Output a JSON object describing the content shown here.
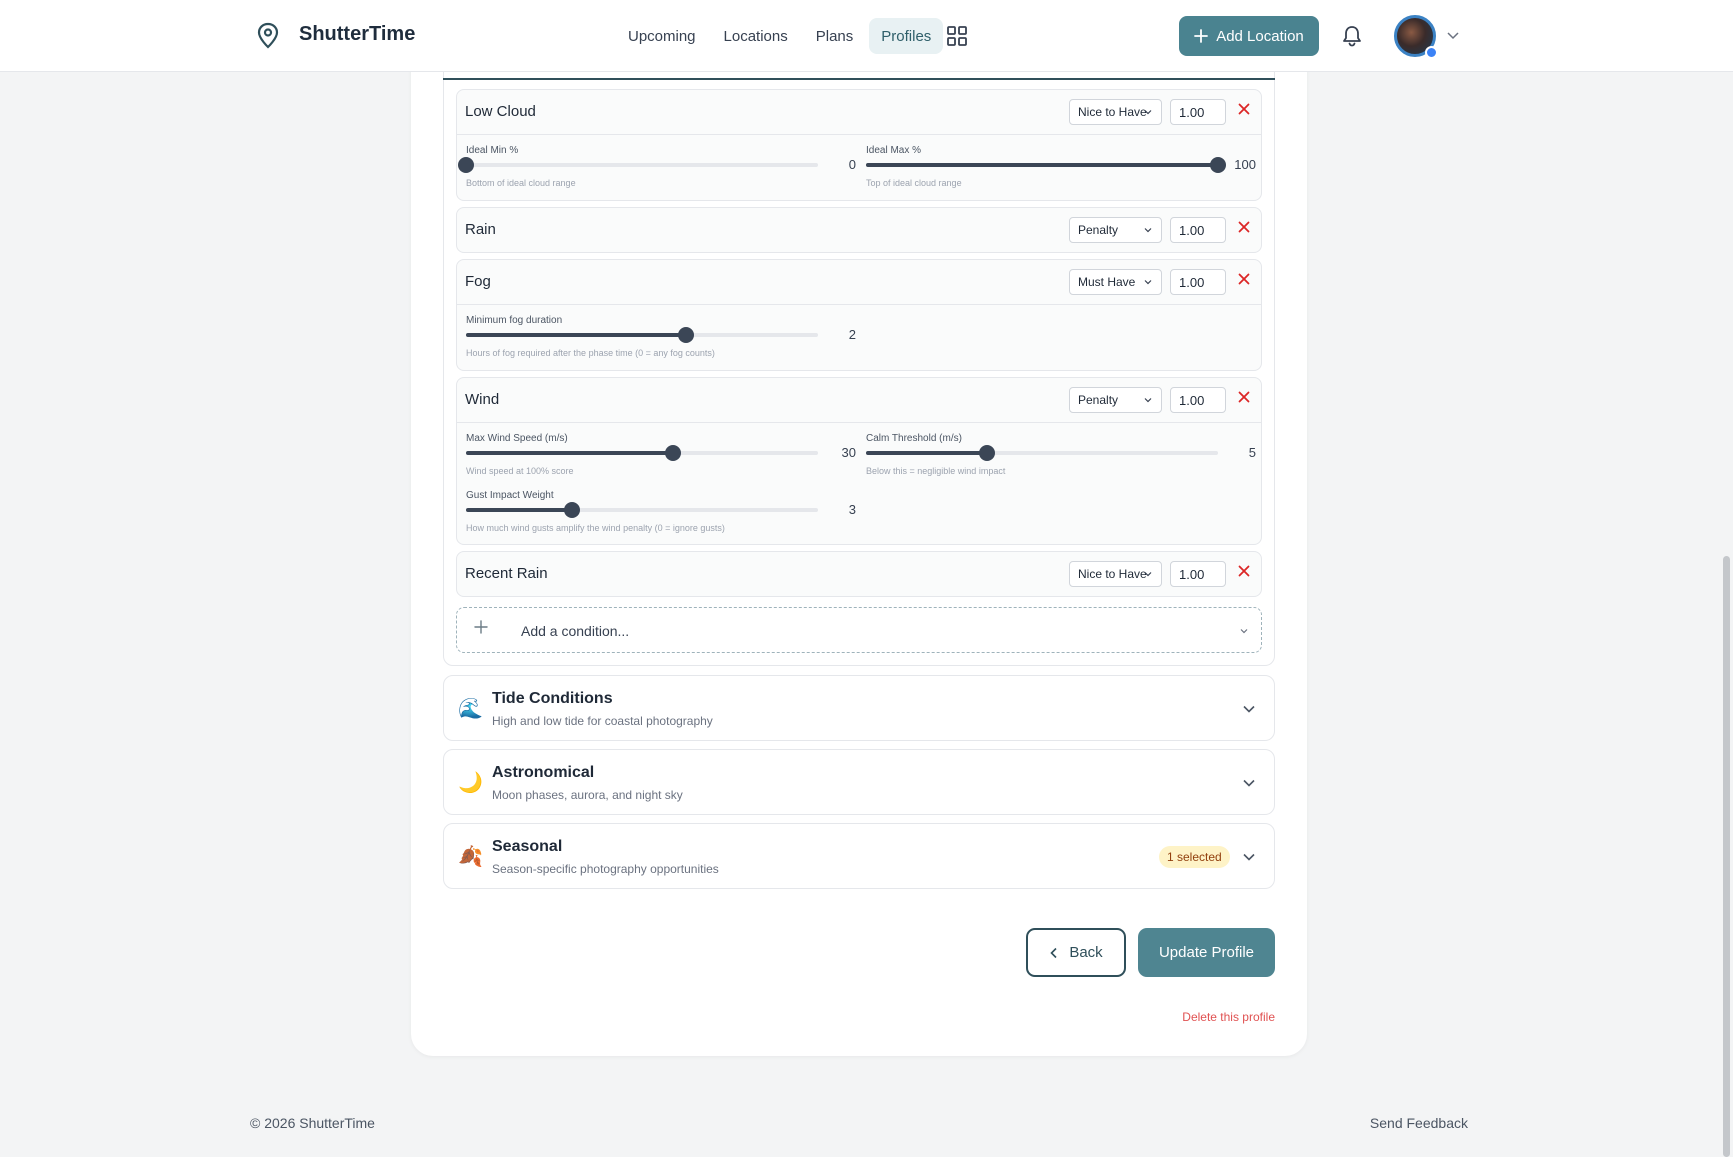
{
  "app": {
    "name": "ShutterTime"
  },
  "nav": [
    {
      "label": "Upcoming",
      "active": false
    },
    {
      "label": "Locations",
      "active": false
    },
    {
      "label": "Plans",
      "active": false
    },
    {
      "label": "Profiles",
      "active": true
    }
  ],
  "header": {
    "add_location_label": "Add Location"
  },
  "conditions": [
    {
      "name": "Low Cloud",
      "priority": "Nice to Have",
      "weight": "1.00",
      "sliders": [
        {
          "label": "Ideal Min %",
          "value": "0",
          "min": 0,
          "max": 100,
          "help": "Bottom of ideal cloud range"
        },
        {
          "label": "Ideal Max %",
          "value": "100",
          "min": 0,
          "max": 100,
          "help": "Top of ideal cloud range"
        }
      ]
    },
    {
      "name": "Rain",
      "priority": "Penalty",
      "weight": "1.00",
      "sliders": []
    },
    {
      "name": "Fog",
      "priority": "Must Have",
      "weight": "1.00",
      "sliders": [
        {
          "label": "Minimum fog duration",
          "value": "2",
          "min": 0,
          "max": 3.2,
          "help": "Hours of fog required after the phase time (0 = any fog counts)"
        }
      ]
    },
    {
      "name": "Wind",
      "priority": "Penalty",
      "weight": "1.00",
      "sliders": [
        {
          "label": "Max Wind Speed (m/s)",
          "value": "30",
          "min": 0,
          "max": 51,
          "help": "Wind speed at 100% score"
        },
        {
          "label": "Calm Threshold (m/s)",
          "value": "5",
          "min": 0,
          "max": 14.5,
          "help": "Below this = negligible wind impact"
        },
        {
          "label": "Gust Impact Weight",
          "value": "3",
          "min": 0,
          "max": 10,
          "help": "How much wind gusts amplify the wind penalty (0 = ignore gusts)"
        }
      ]
    },
    {
      "name": "Recent Rain",
      "priority": "Nice to Have",
      "weight": "1.00",
      "sliders": []
    }
  ],
  "add_condition": {
    "placeholder": "Add a condition..."
  },
  "sections": [
    {
      "emoji": "🌊",
      "title": "Tide Conditions",
      "subtitle": "High and low tide for coastal photography",
      "badge": ""
    },
    {
      "emoji": "🌙",
      "title": "Astronomical",
      "subtitle": "Moon phases, aurora, and night sky",
      "badge": ""
    },
    {
      "emoji": "🍂",
      "title": "Seasonal",
      "subtitle": "Season-specific photography opportunities",
      "badge": "1 selected"
    }
  ],
  "actions": {
    "back_label": "Back",
    "update_label": "Update Profile",
    "delete_label": "Delete this profile"
  },
  "footer": {
    "copyright": "© 2026 ShutterTime",
    "feedback": "Send Feedback"
  },
  "colors": {
    "accent": "#4a8390",
    "danger": "#dc2626",
    "slider": "#3b4656"
  }
}
